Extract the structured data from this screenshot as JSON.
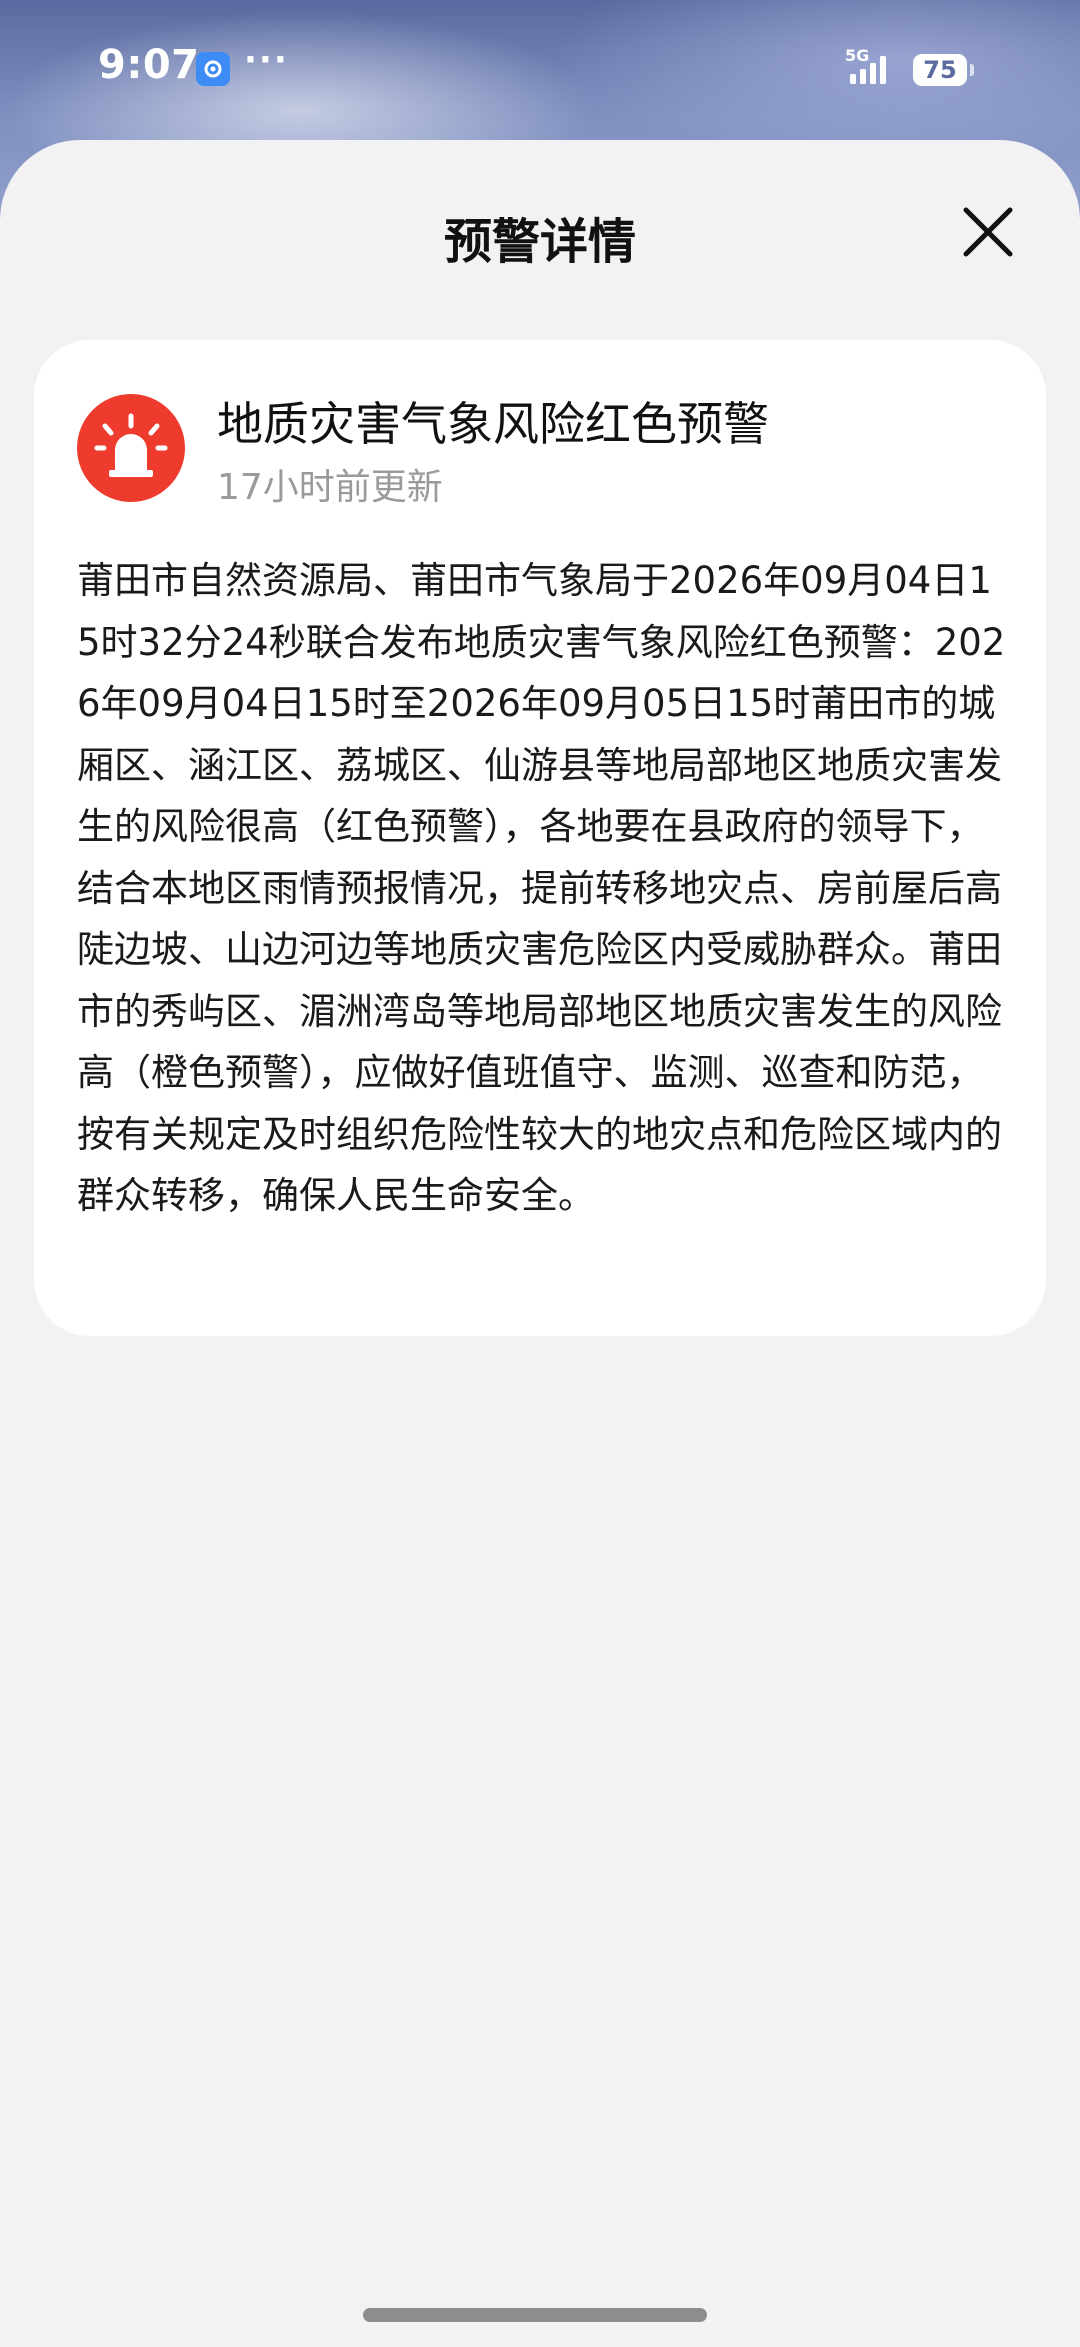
{
  "status_bar": {
    "time": "9:07",
    "network": "5G",
    "battery": "75",
    "more_indicator": "···"
  },
  "sheet": {
    "title": "预警详情"
  },
  "alert": {
    "title": "地质灾害气象风险红色预警",
    "updated": "17小时前更新",
    "body": "莆田市自然资源局、莆田市气象局于2026年09月04日15时32分24秒联合发布地质灾害气象风险红色预警：2026年09月04日15时至2026年09月05日15时莆田市的城厢区、涵江区、荔城区、仙游县等地局部地区地质灾害发生的风险很高（红色预警），各地要在县政府的领导下，结合本地区雨情预报情况，提前转移地灾点、房前屋后高陡边坡、山边河边等地质灾害危险区内受威胁群众。莆田市的秀屿区、湄洲湾岛等地局部地区地质灾害发生的风险高（橙色预警），应做好值班值守、监测、巡查和防范，按有关规定及时组织危险性较大的地灾点和危险区域内的群众转移，确保人民生命安全。",
    "icon_color": "#ef3b2d"
  },
  "icons": {
    "close": "close-icon",
    "alarm": "alarm-light-icon"
  }
}
